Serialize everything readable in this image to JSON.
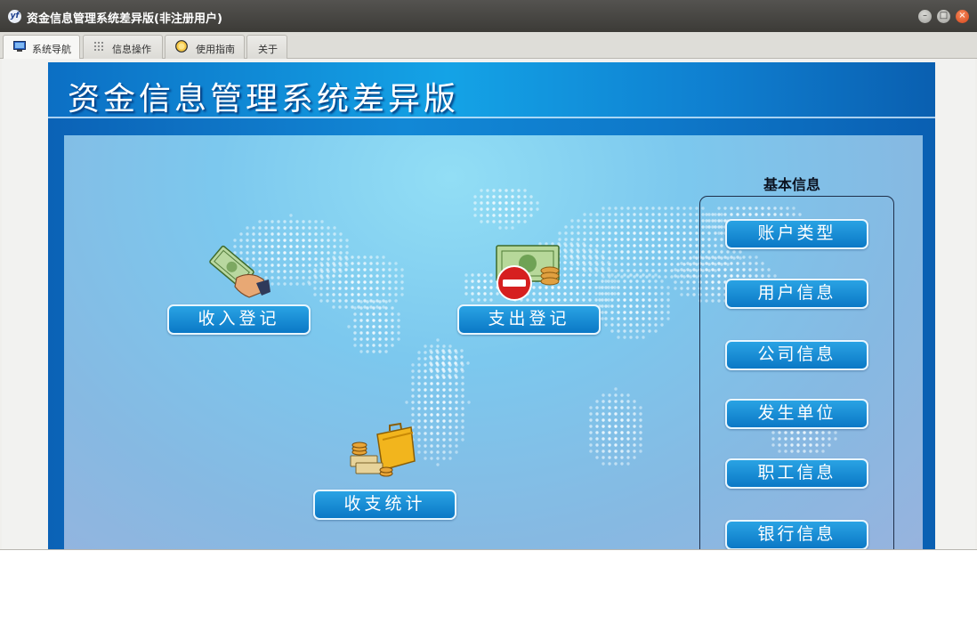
{
  "window": {
    "title": "资金信息管理系统差异版(非注册用户)",
    "app_icon": "yf-logo-icon",
    "controls": [
      "minimize-icon",
      "maximize-icon",
      "close-icon"
    ]
  },
  "tabs": [
    {
      "label": "系统导航",
      "icon": "monitor-icon",
      "active": true
    },
    {
      "label": "信息操作",
      "icon": "grid-icon",
      "active": false
    },
    {
      "label": "使用指南",
      "icon": "guide-icon",
      "active": false
    },
    {
      "label": "关于",
      "icon": "",
      "active": false
    }
  ],
  "banner": {
    "title": "资金信息管理系统差异版"
  },
  "features": {
    "income": {
      "label": "收入登记",
      "icon": "money-hand-icon"
    },
    "expense": {
      "label": "支出登记",
      "icon": "money-stop-icon"
    },
    "stats": {
      "label": "收支统计",
      "icon": "briefcase-coins-icon"
    }
  },
  "basic_info": {
    "heading": "基本信息",
    "items": [
      "账户类型",
      "用户信息",
      "公司信息",
      "发生单位",
      "职工信息",
      "银行信息"
    ]
  },
  "colors": {
    "titlebar": "#3c3b37",
    "banner_blue": "#0e78c9",
    "button_blue": "#1a8fd8",
    "close_orange": "#e5552a"
  }
}
